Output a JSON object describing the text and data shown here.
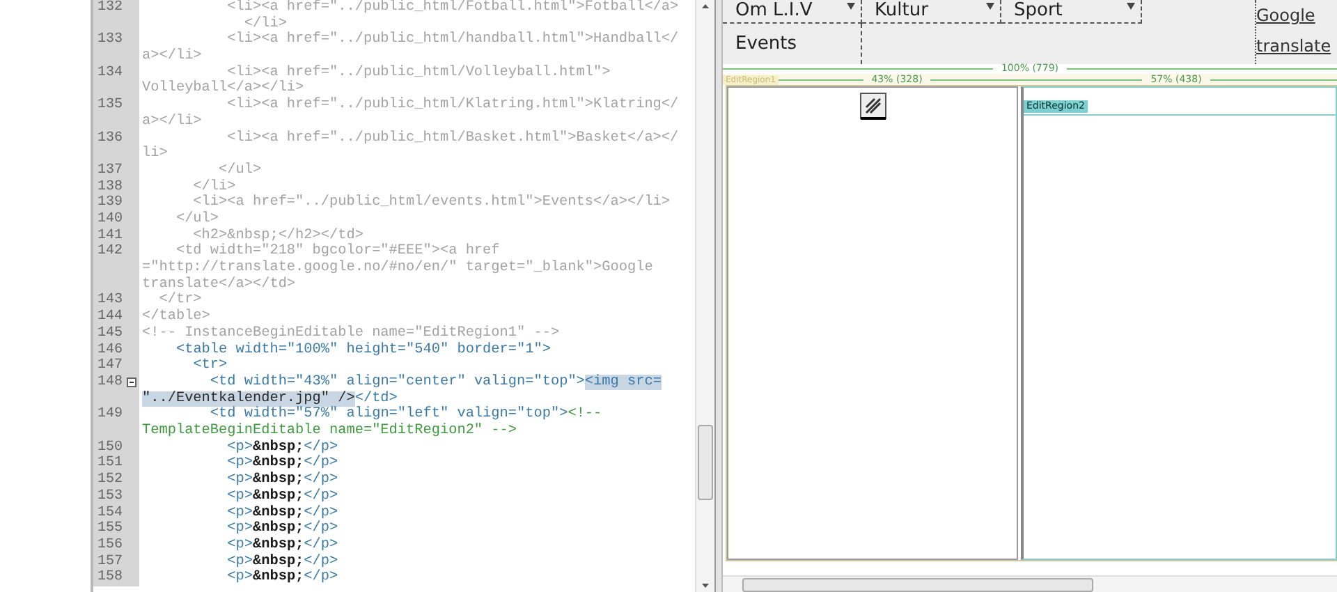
{
  "code_view": {
    "lines": [
      {
        "number": "132",
        "kind": "locked",
        "fold": false,
        "rows": [
          {
            "text": "          <li><a href=\"../public_html/Fotball.html\">Fotball</a>"
          },
          {
            "text": "            </li>"
          }
        ]
      },
      {
        "number": "133",
        "kind": "locked",
        "fold": false,
        "rows": [
          {
            "text": "          <li><a href=\"../public_html/handball.html\">Handball</"
          },
          {
            "text": "a></li>"
          }
        ]
      },
      {
        "number": "134",
        "kind": "locked",
        "fold": false,
        "rows": [
          {
            "text": "          <li><a href=\"../public_html/Volleyball.html\">"
          },
          {
            "text": "Volleyball</a></li>"
          }
        ]
      },
      {
        "number": "135",
        "kind": "locked",
        "fold": false,
        "rows": [
          {
            "text": "          <li><a href=\"../public_html/Klatring.html\">Klatring</"
          },
          {
            "text": "a></li>"
          }
        ]
      },
      {
        "number": "136",
        "kind": "locked",
        "fold": false,
        "rows": [
          {
            "text": "          <li><a href=\"../public_html/Basket.html\">Basket</a></"
          },
          {
            "text": "li>"
          }
        ]
      },
      {
        "number": "137",
        "kind": "locked",
        "fold": false,
        "rows": [
          {
            "text": "         </ul>"
          }
        ]
      },
      {
        "number": "138",
        "kind": "locked",
        "fold": false,
        "rows": [
          {
            "text": "      </li>"
          }
        ]
      },
      {
        "number": "139",
        "kind": "locked",
        "fold": false,
        "rows": [
          {
            "text": "      <li><a href=\"../public_html/events.html\">Events</a></li>"
          }
        ]
      },
      {
        "number": "140",
        "kind": "locked",
        "fold": false,
        "rows": [
          {
            "text": "    </ul>"
          }
        ]
      },
      {
        "number": "141",
        "kind": "locked",
        "fold": false,
        "rows": [
          {
            "text": "      <h2>&nbsp;</h2></td>"
          }
        ]
      },
      {
        "number": "142",
        "kind": "locked",
        "fold": false,
        "rows": [
          {
            "text": "    <td width=\"218\" bgcolor=\"#EEE\"><a href"
          },
          {
            "text": "=\"http://translate.google.no/#no/en/\" target=\"_blank\">Google"
          },
          {
            "text": "translate</a></td>"
          }
        ]
      },
      {
        "number": "143",
        "kind": "locked",
        "fold": false,
        "rows": [
          {
            "text": "  </tr>"
          }
        ]
      },
      {
        "number": "144",
        "kind": "locked",
        "fold": false,
        "rows": [
          {
            "text": "</table>"
          }
        ]
      },
      {
        "number": "145",
        "kind": "locked",
        "fold": false,
        "rows": [
          {
            "text": "<!-- InstanceBeginEditable name=\"EditRegion1\" -->"
          }
        ]
      },
      {
        "number": "146",
        "kind": "editable",
        "fold": false,
        "rows": [
          {
            "text": "    <table width=\"100%\" height=\"540\" border=\"1\">"
          }
        ]
      },
      {
        "number": "147",
        "kind": "editable",
        "fold": false,
        "rows": [
          {
            "text": "      <tr>"
          }
        ]
      },
      {
        "number": "148",
        "kind": "editable",
        "fold": true,
        "rows": [
          {
            "text": "        <td width=\"43%\" align=\"center\" valign=\"top\">",
            "selection": "<img src="
          },
          {
            "text": "",
            "selection": "\"../Eventkalender.jpg\" />",
            "after": "</td>"
          }
        ]
      },
      {
        "number": "149",
        "kind": "editable",
        "fold": false,
        "rows": [
          {
            "text": "        <td width=\"57%\" align=\"left\" valign=\"top\"><!--"
          },
          {
            "text": "TemplateBeginEditable name=\"EditRegion2\" -->"
          }
        ]
      },
      {
        "number": "150",
        "kind": "editable",
        "fold": false,
        "rows": [
          {
            "text": "          <p>&nbsp;</p>"
          }
        ]
      },
      {
        "number": "151",
        "kind": "editable",
        "fold": false,
        "rows": [
          {
            "text": "          <p>&nbsp;</p>"
          }
        ]
      },
      {
        "number": "152",
        "kind": "editable",
        "fold": false,
        "rows": [
          {
            "text": "          <p>&nbsp;</p>"
          }
        ]
      },
      {
        "number": "153",
        "kind": "editable",
        "fold": false,
        "rows": [
          {
            "text": "          <p>&nbsp;</p>"
          }
        ]
      },
      {
        "number": "154",
        "kind": "editable",
        "fold": false,
        "rows": [
          {
            "text": "          <p>&nbsp;</p>"
          }
        ]
      },
      {
        "number": "155",
        "kind": "editable",
        "fold": false,
        "rows": [
          {
            "text": "          <p>&nbsp;</p>"
          }
        ]
      },
      {
        "number": "156",
        "kind": "editable",
        "fold": false,
        "rows": [
          {
            "text": "          <p>&nbsp;</p>"
          }
        ]
      },
      {
        "number": "157",
        "kind": "editable",
        "fold": false,
        "rows": [
          {
            "text": "          <p>&nbsp;</p>"
          }
        ]
      },
      {
        "number": "158",
        "kind": "editable",
        "fold": false,
        "rows": [
          {
            "text": "          <p>&nbsp;</p>"
          }
        ]
      }
    ]
  },
  "design_view": {
    "nav": [
      {
        "label": "Om L.I.V",
        "dropdown": true
      },
      {
        "label": "Kultur",
        "dropdown": true
      },
      {
        "label": "Sport",
        "dropdown": true
      }
    ],
    "nav_row_2": [
      {
        "label": "Events",
        "dropdown": false
      }
    ],
    "link": "Google translate",
    "table_width": "100% (779)",
    "region_1": {
      "label": "EditRegion1",
      "width": "43% (328)"
    },
    "region_2": {
      "label": "EditRegion2",
      "width": "57% (438)"
    }
  }
}
